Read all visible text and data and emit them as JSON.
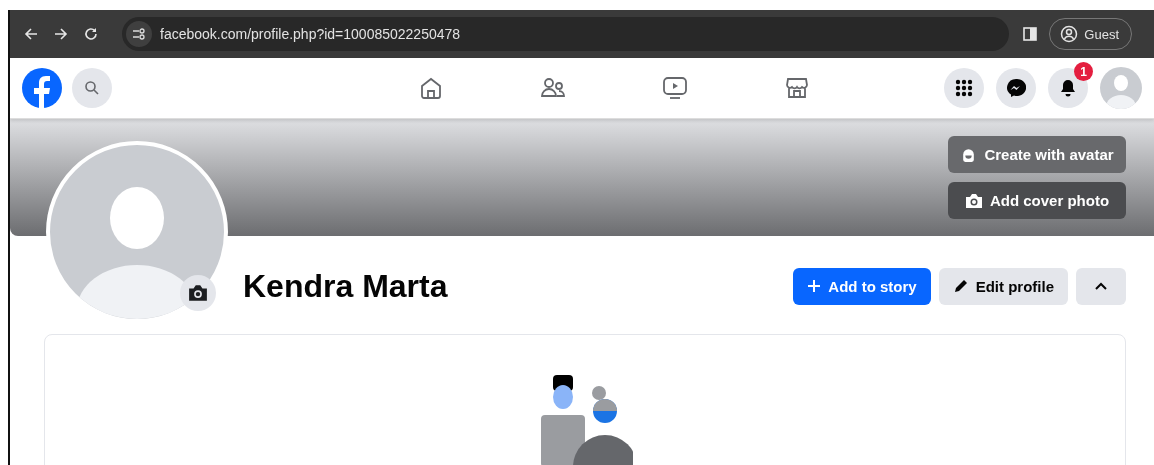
{
  "browser": {
    "url": "facebook.com/profile.php?id=100085022250478",
    "profile_label": "Guest"
  },
  "top_bar": {
    "notification_count": "1"
  },
  "cover": {
    "buttons": [
      {
        "label": "Create with avatar",
        "kind": "avatar"
      },
      {
        "label": "Add cover photo",
        "kind": "camera"
      }
    ]
  },
  "profile": {
    "name": "Kendra Marta",
    "actions": [
      {
        "label": "Add to story",
        "kind": "primary"
      },
      {
        "label": "Edit profile",
        "kind": "secondary"
      }
    ]
  }
}
